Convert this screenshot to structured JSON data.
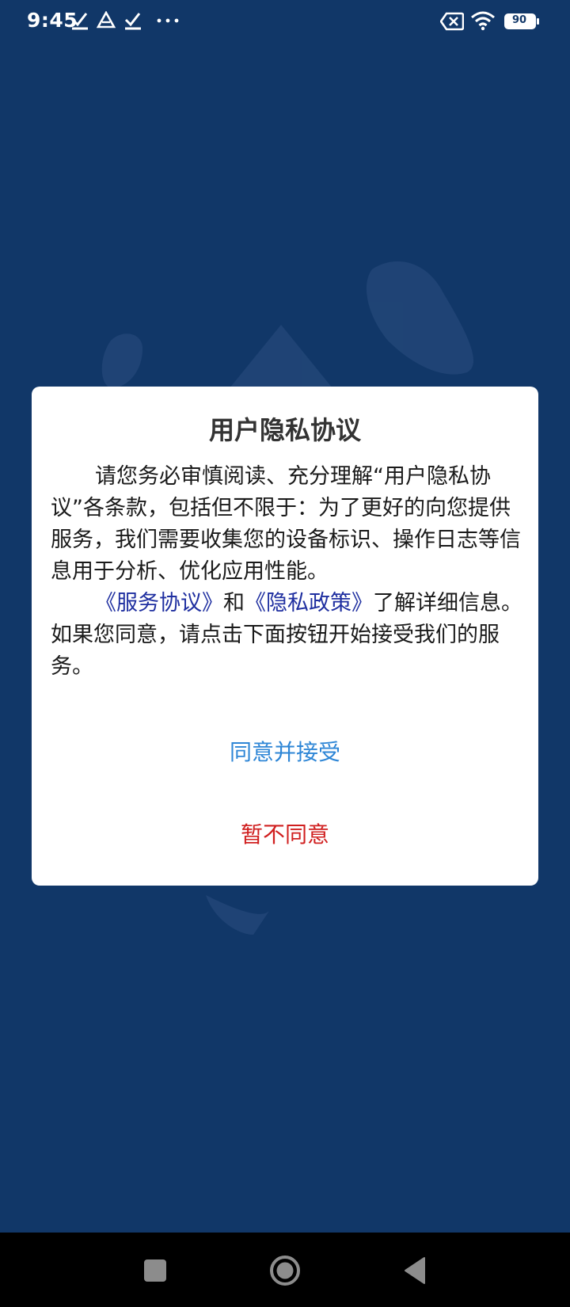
{
  "status_bar": {
    "time": "9:45",
    "battery_level": "90",
    "icons": [
      "check-icon",
      "drive-icon",
      "check-icon",
      "more-dots-icon",
      "sim-error-icon",
      "wifi-icon",
      "battery-icon"
    ]
  },
  "dialog": {
    "title": "用户隐私协议",
    "paragraph1": "请您务必审慎阅读、充分理解“用户隐私协议”各条款，包括但不限于：为了更好的向您提供服务，我们需要收集您的设备标识、操作日志等信息用于分析、优化应用性能。",
    "service_link": "《服务协议》",
    "and_text": "和",
    "privacy_link": "《隐私政策》",
    "paragraph2_rest": "了解详细信息。如果您同意，请点击下面按钮开始接受我们的服务。",
    "agree_label": "同意并接受",
    "disagree_label": "暂不同意"
  },
  "nav_bar": {
    "buttons": [
      "recents-button",
      "home-button",
      "back-button"
    ]
  },
  "colors": {
    "background": "#113768",
    "dialog": "#ffffff",
    "agree": "#2e86d6",
    "disagree": "#d01f1f",
    "link": "#1f2fa0"
  }
}
